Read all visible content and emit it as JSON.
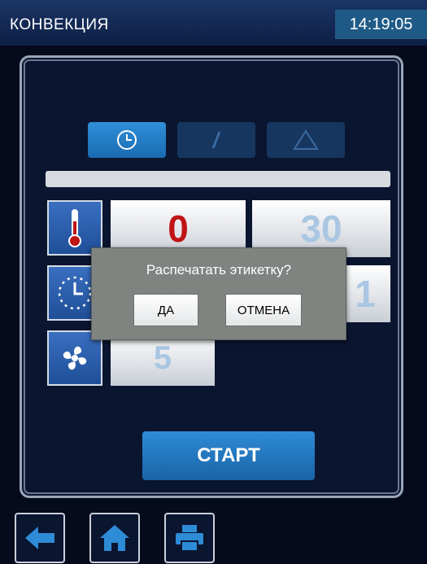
{
  "header": {
    "title": "КОНВЕКЦИЯ",
    "clock": "14:19:05"
  },
  "mode_tabs": [
    {
      "icon": "clock-icon",
      "active": true
    },
    {
      "icon": "probe-icon",
      "active": false
    },
    {
      "icon": "delta-icon",
      "active": false
    }
  ],
  "params": {
    "temperature": {
      "icon": "thermometer-icon",
      "current": "0",
      "set": "30"
    },
    "time": {
      "icon": "timer-icon",
      "set": "1"
    },
    "fan": {
      "icon": "fan-icon",
      "set": "5"
    }
  },
  "start_label": "СТАРТ",
  "dialog": {
    "message": "Распечатать этикетку?",
    "yes": "ДА",
    "cancel": "ОТМЕНА"
  },
  "bottom_nav": [
    {
      "icon": "back-arrow-icon"
    },
    {
      "icon": "home-icon"
    },
    {
      "icon": "printer-icon"
    }
  ],
  "colors": {
    "accent": "#1f5a86",
    "active_value": "#c01414",
    "background": "#050b1c"
  }
}
